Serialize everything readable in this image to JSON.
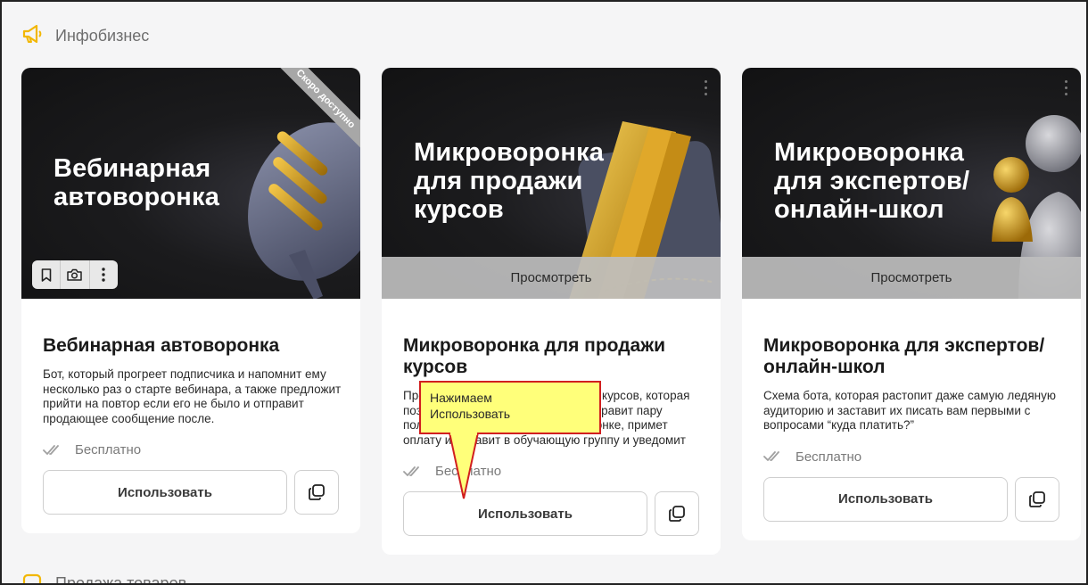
{
  "section": {
    "title": "Инфобизнес",
    "next_title": "Продажа товаров"
  },
  "cards": [
    {
      "cover_lines": [
        "Вебинарная",
        "автоворонка"
      ],
      "ribbon": "Скоро доступно",
      "title": "Вебинарная автоворонка",
      "description": "Бот, который прогреет подписчика и напомнит ему несколько раз о старте вебинара, а также предложит прийти на повтор если его не было и отправит продающее сообщение после.",
      "price": "Бесплатно",
      "use_label": "Использовать"
    },
    {
      "cover_lines": [
        "Микроворонка",
        "для продажи",
        "курсов"
      ],
      "preview_label": "Просмотреть",
      "title": "Микроворонка для продажи курсов",
      "description": "Простая автоворонка для продажи курсов, которая познакомит подписчика с вами, отправит пару полезных постов, проведёт по воронке, примет оплату и добавит в обучающую группу и уведомит вас об…",
      "price": "Бесплатно",
      "use_label": "Использовать"
    },
    {
      "cover_lines": [
        "Микроворонка",
        "для экспертов/",
        "онлайн-школ"
      ],
      "preview_label": "Просмотреть",
      "title": "Микроворонка для экспертов/онлайн-школ",
      "description": "Схема бота, которая растопит даже самую ледяную аудиторию и заставит их писать вам первыми с вопросами “куда платить?”",
      "price": "Бесплатно",
      "use_label": "Использовать"
    }
  ],
  "callout": {
    "line1": "Нажимаем",
    "line2": "Использовать"
  },
  "colors": {
    "accent": "#f2b705",
    "callout_bg": "#ffff7a",
    "callout_border": "#d11f1f",
    "gold": "#d9a21c"
  }
}
